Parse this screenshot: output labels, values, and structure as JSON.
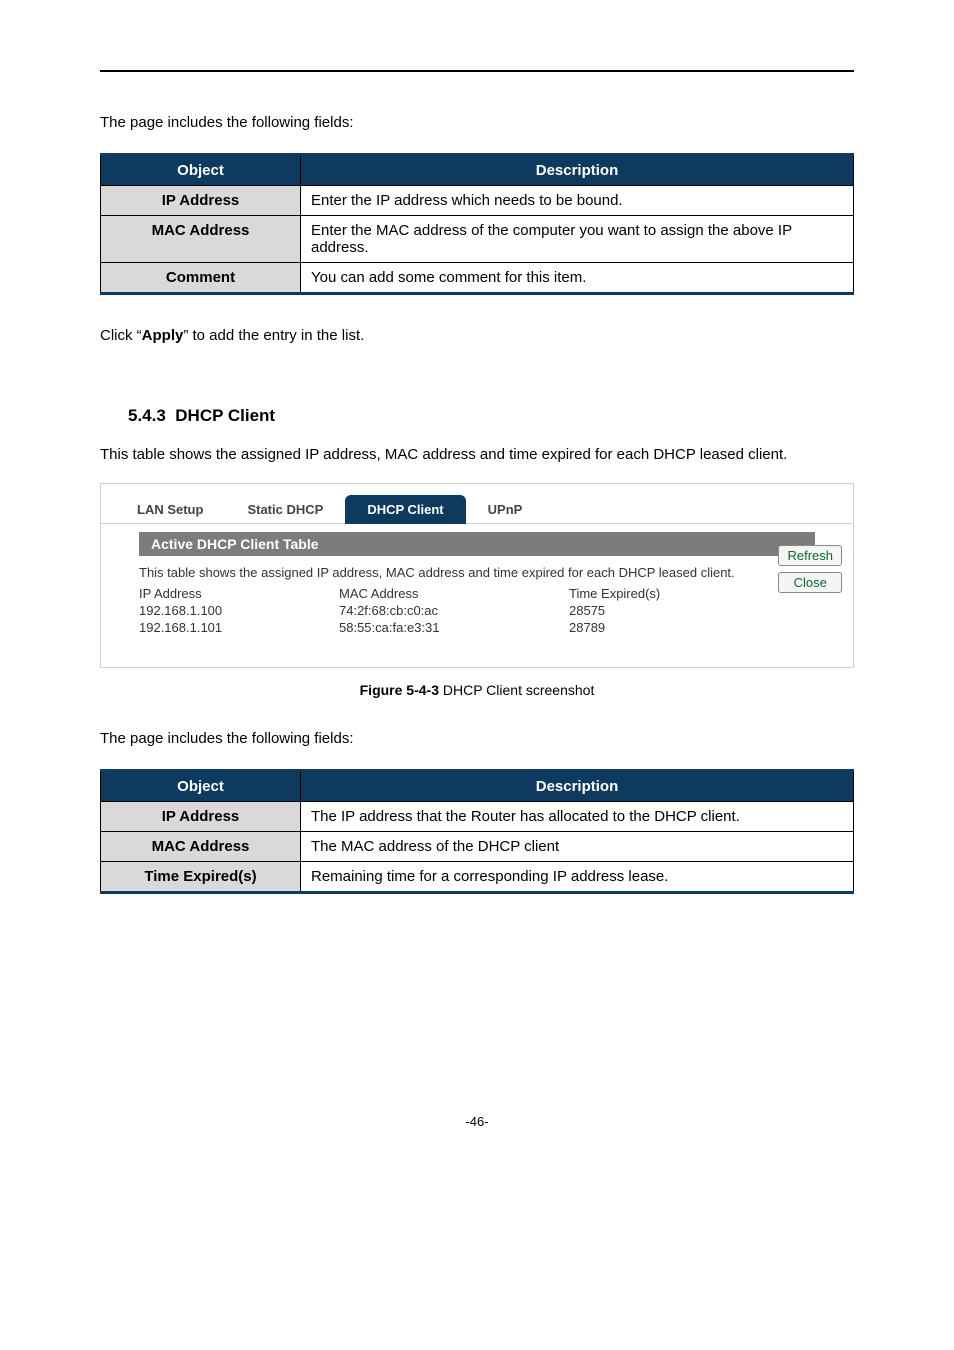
{
  "intro1": "The page includes the following fields:",
  "table1": {
    "header_object": "Object",
    "header_desc": "Description",
    "rows": [
      {
        "object": "IP Address",
        "desc": "Enter the IP address which needs to be bound."
      },
      {
        "object": "MAC Address",
        "desc": "Enter the MAC address of the computer you want to assign the above IP address."
      },
      {
        "object": "Comment",
        "desc": "You can add some comment for this item."
      }
    ]
  },
  "click_prefix": "Click “",
  "click_bold": "Apply",
  "click_suffix": "” to add the entry in the list.",
  "section_number": "5.4.3",
  "section_title": "DHCP Client",
  "section_intro": "This table shows the assigned IP address, MAC address and time expired for each DHCP leased client.",
  "screenshot": {
    "tabs": [
      "LAN Setup",
      "Static DHCP",
      "DHCP Client",
      "UPnP"
    ],
    "active_tab_index": 2,
    "panel_title": "Active DHCP Client Table",
    "panel_desc": "This table shows the assigned IP address, MAC address and time expired for each DHCP leased client.",
    "col_headers": [
      "IP Address",
      "MAC Address",
      "Time Expired(s)"
    ],
    "rows": [
      {
        "ip": "192.168.1.100",
        "mac": "74:2f:68:cb:c0:ac",
        "time": "28575"
      },
      {
        "ip": "192.168.1.101",
        "mac": "58:55:ca:fa:e3:31",
        "time": "28789"
      }
    ],
    "btn_refresh": "Refresh",
    "btn_close": "Close"
  },
  "caption_bold": "Figure 5-4-3",
  "caption_rest": " DHCP Client screenshot",
  "intro2": "The page includes the following fields:",
  "table2": {
    "header_object": "Object",
    "header_desc": "Description",
    "rows": [
      {
        "object": "IP Address",
        "desc": "The IP address that the Router has allocated to the DHCP client."
      },
      {
        "object": "MAC Address",
        "desc": "The MAC address of the DHCP client"
      },
      {
        "object": "Time Expired(s)",
        "desc": "Remaining time for a corresponding IP address lease."
      }
    ]
  },
  "page_number": "-46-"
}
